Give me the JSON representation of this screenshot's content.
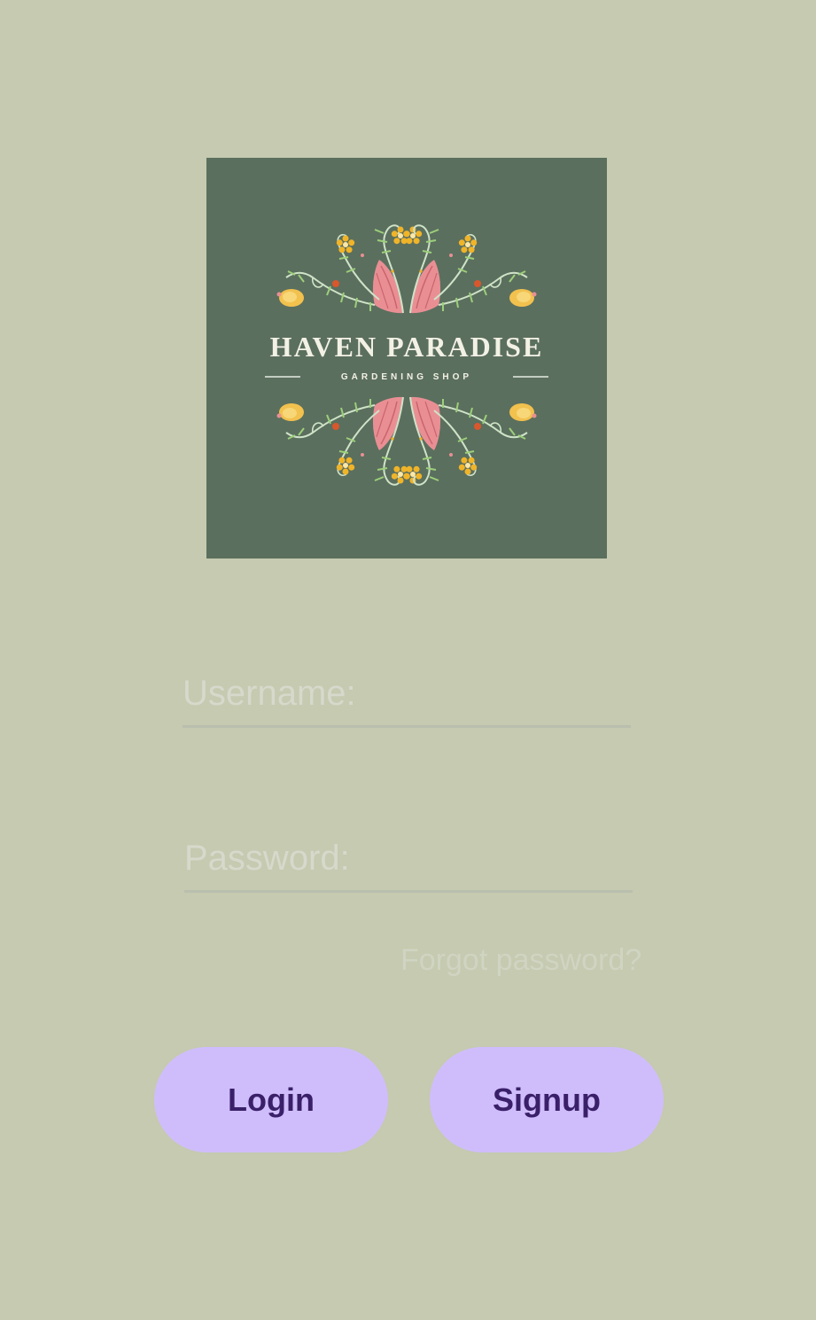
{
  "logo": {
    "title": "HAVEN PARADISE",
    "subtitle": "GARDENING SHOP",
    "background": "#5b6f5e"
  },
  "form": {
    "username_placeholder": "Username:",
    "username_value": "",
    "password_placeholder": "Password:",
    "password_value": "",
    "forgot_label": "Forgot password?"
  },
  "actions": {
    "login_label": "Login",
    "signup_label": "Signup"
  },
  "colors": {
    "background": "#c5cab0",
    "button": "#cfbdfb",
    "button_text": "#3a2068",
    "petal": "#e98f94",
    "flower": "#f0b429"
  }
}
